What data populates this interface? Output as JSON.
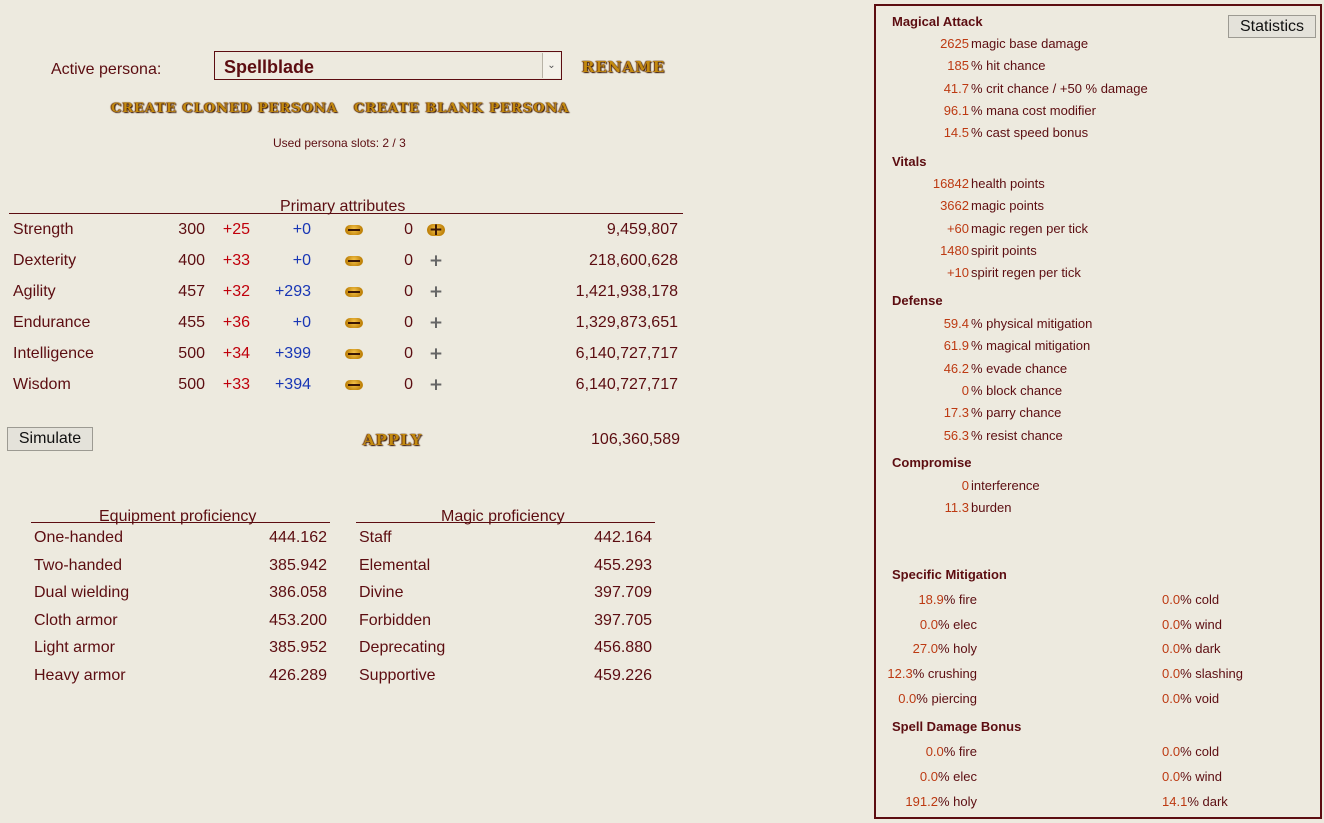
{
  "persona": {
    "label": "Active persona:",
    "selected": "Spellblade",
    "rename": "RENAME",
    "create_cloned": "CREATE CLONED PERSONA",
    "create_blank": "CREATE BLANK PERSONA",
    "slots": "Used persona slots: 2 / 3"
  },
  "primary": {
    "title": "Primary attributes",
    "rows": [
      {
        "name": "Strength",
        "base": "300",
        "bonus": "+25",
        "equip": "+0",
        "count": "0",
        "cost": "9,459,807"
      },
      {
        "name": "Dexterity",
        "base": "400",
        "bonus": "+33",
        "equip": "+0",
        "count": "0",
        "cost": "218,600,628"
      },
      {
        "name": "Agility",
        "base": "457",
        "bonus": "+32",
        "equip": "+293",
        "count": "0",
        "cost": "1,421,938,178"
      },
      {
        "name": "Endurance",
        "base": "455",
        "bonus": "+36",
        "equip": "+0",
        "count": "0",
        "cost": "1,329,873,651"
      },
      {
        "name": "Intelligence",
        "base": "500",
        "bonus": "+34",
        "equip": "+399",
        "count": "0",
        "cost": "6,140,727,717"
      },
      {
        "name": "Wisdom",
        "base": "500",
        "bonus": "+33",
        "equip": "+394",
        "count": "0",
        "cost": "6,140,727,717"
      }
    ],
    "simulate": "Simulate",
    "apply": "APPLY",
    "total": "106,360,589"
  },
  "equipment": {
    "title": "Equipment proficiency",
    "rows": [
      {
        "name": "One-handed",
        "value": "444.162"
      },
      {
        "name": "Two-handed",
        "value": "385.942"
      },
      {
        "name": "Dual wielding",
        "value": "386.058"
      },
      {
        "name": "Cloth armor",
        "value": "453.200"
      },
      {
        "name": "Light armor",
        "value": "385.952"
      },
      {
        "name": "Heavy armor",
        "value": "426.289"
      }
    ]
  },
  "magic": {
    "title": "Magic proficiency",
    "rows": [
      {
        "name": "Staff",
        "value": "442.164"
      },
      {
        "name": "Elemental",
        "value": "455.293"
      },
      {
        "name": "Divine",
        "value": "397.709"
      },
      {
        "name": "Forbidden",
        "value": "397.705"
      },
      {
        "name": "Deprecating",
        "value": "456.880"
      },
      {
        "name": "Supportive",
        "value": "459.226"
      }
    ]
  },
  "stats": {
    "button": "Statistics",
    "magical_attack": {
      "title": "Magical Attack",
      "rows": [
        {
          "num": "2625",
          "label": "magic base damage"
        },
        {
          "num": "185",
          "label": "% hit chance"
        },
        {
          "num": "41.7",
          "label": "% crit chance / +50 % damage"
        },
        {
          "num": "96.1",
          "label": "% mana cost modifier"
        },
        {
          "num": "14.5",
          "label": "% cast speed bonus"
        }
      ]
    },
    "vitals": {
      "title": "Vitals",
      "rows": [
        {
          "num": "16842",
          "label": "health points"
        },
        {
          "num": "3662",
          "label": "magic points"
        },
        {
          "num": "+60",
          "label": "magic regen per tick"
        },
        {
          "num": "1480",
          "label": "spirit points"
        },
        {
          "num": "+10",
          "label": "spirit regen per tick"
        }
      ]
    },
    "defense": {
      "title": "Defense",
      "rows": [
        {
          "num": "59.4",
          "label": "% physical mitigation"
        },
        {
          "num": "61.9",
          "label": "% magical mitigation"
        },
        {
          "num": "46.2",
          "label": "% evade chance"
        },
        {
          "num": "0",
          "label": "% block chance"
        },
        {
          "num": "17.3",
          "label": "% parry chance"
        },
        {
          "num": "56.3",
          "label": "% resist chance"
        }
      ]
    },
    "compromise": {
      "title": "Compromise",
      "rows": [
        {
          "num": "0",
          "label": "interference"
        },
        {
          "num": "11.3",
          "label": "burden"
        }
      ]
    },
    "specific_mitigation": {
      "title": "Specific Mitigation",
      "rows": [
        {
          "l_num": "18.9",
          "l_label": "% fire",
          "r_num": "0.0",
          "r_label": "% cold"
        },
        {
          "l_num": "0.0",
          "l_label": "% elec",
          "r_num": "0.0",
          "r_label": "% wind"
        },
        {
          "l_num": "27.0",
          "l_label": "% holy",
          "r_num": "0.0",
          "r_label": "% dark"
        },
        {
          "l_num": "12.3",
          "l_label": "% crushing",
          "r_num": "0.0",
          "r_label": "% slashing"
        },
        {
          "l_num": "0.0",
          "l_label": "% piercing",
          "r_num": "0.0",
          "r_label": "% void"
        }
      ]
    },
    "spell_damage_bonus": {
      "title": "Spell Damage Bonus",
      "rows": [
        {
          "l_num": "0.0",
          "l_label": "% fire",
          "r_num": "0.0",
          "r_label": "% cold"
        },
        {
          "l_num": "0.0",
          "l_label": "% elec",
          "r_num": "0.0",
          "r_label": "% wind"
        },
        {
          "l_num": "191.2",
          "l_label": "% holy",
          "r_num": "14.1",
          "r_label": "% dark"
        }
      ]
    }
  }
}
